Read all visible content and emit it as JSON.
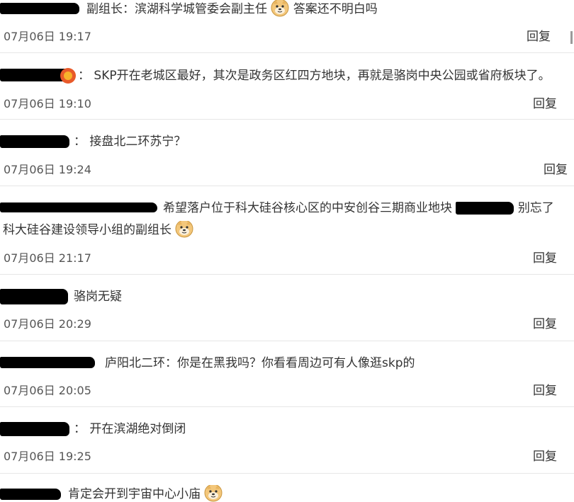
{
  "reply_label": "回复",
  "comments": [
    {
      "text_parts": [
        "副组长：滨湖科学城管委会副主任",
        "答案还不明白吗"
      ],
      "emoji_count": 1,
      "time": "07月06日 19:17"
    },
    {
      "text_parts": [
        "：  SKP开在老城区最好，其次是政务区红四方地块，再就是骆岗中央公园或省府板块了。"
      ],
      "time": "07月06日 19:10"
    },
    {
      "text_parts": [
        "：  接盘北二环苏宁？"
      ],
      "time": "07月06日 19:24"
    },
    {
      "text_parts": [
        "希望落户位于科大硅谷核心区的中安创谷三期商业地块",
        "别忘了"
      ],
      "text_line2": "科大硅谷建设领导小组的副组长",
      "time": "07月06日 21:17"
    },
    {
      "text_parts": [
        "骆岗无疑"
      ],
      "time": "07月06日 20:29"
    },
    {
      "text_parts": [
        "庐阳北二环：你是在黑我吗？你看看周边可有人像逛skp的"
      ],
      "time": "07月06日 20:05"
    },
    {
      "text_parts": [
        "：  开在滨湖绝对倒闭"
      ],
      "time": "07月06日 19:25"
    },
    {
      "text_parts": [
        "肯定会开到宇宙中心小庙"
      ]
    }
  ]
}
